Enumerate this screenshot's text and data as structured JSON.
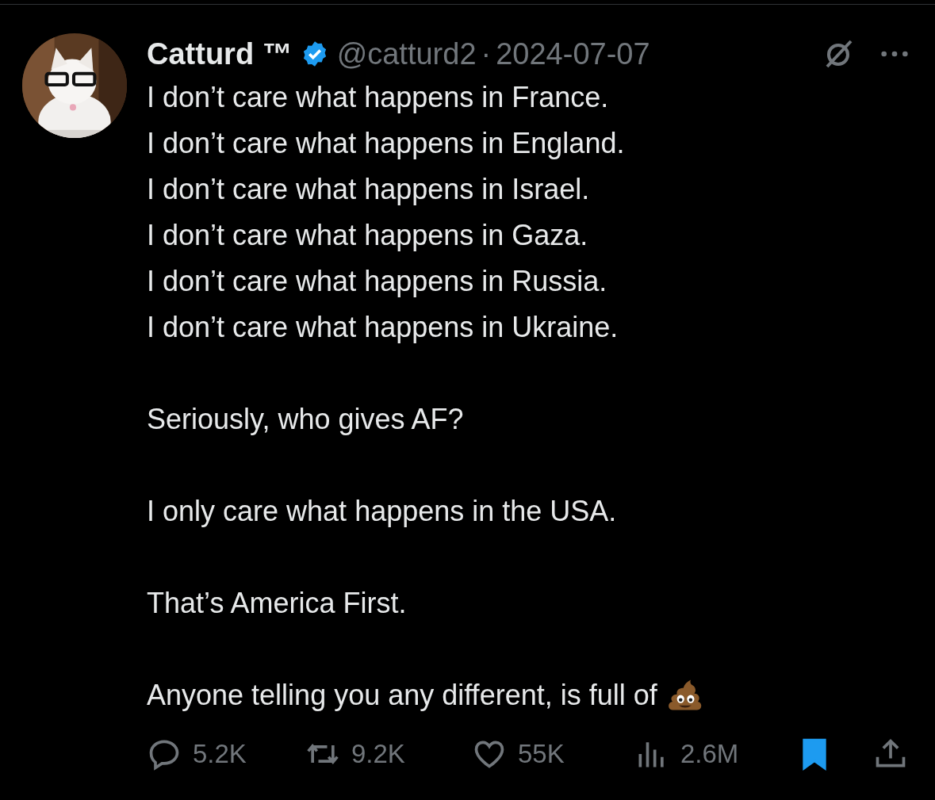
{
  "author": {
    "name": "Catturd ™",
    "verified": true,
    "handle": "@catturd2",
    "separator": "·",
    "date": "2024-07-07"
  },
  "paragraphs": [
    {
      "kind": "text",
      "lines": [
        "I don’t care what happens in France.",
        "I don’t care what happens in England.",
        "I don’t care what happens in Israel.",
        "I don’t care what happens in Gaza.",
        "I don’t care what happens in Russia.",
        "I don’t care what happens in Ukraine."
      ]
    },
    {
      "kind": "text",
      "lines": [
        "Seriously, who gives AF?"
      ]
    },
    {
      "kind": "text",
      "lines": [
        "I only care what happens in the USA."
      ]
    },
    {
      "kind": "text",
      "lines": [
        "That’s America First."
      ]
    },
    {
      "kind": "ending-icon",
      "lines": [
        "Anyone telling you any different, is full of"
      ]
    }
  ],
  "stats": {
    "replies": "5.2K",
    "reposts": "9.2K",
    "likes": "55K",
    "views": "2.6M"
  },
  "bookmarked": true
}
